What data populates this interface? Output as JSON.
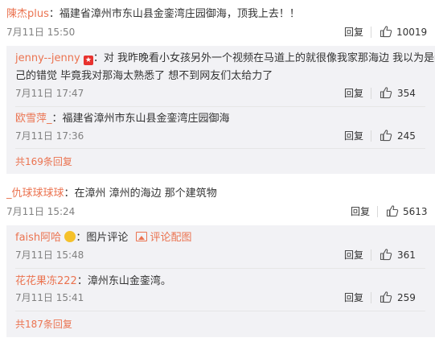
{
  "comments": [
    {
      "user": "陳杰plus",
      "text": "：福建省漳州市东山县金銮湾庄园御海，顶我上去！！",
      "time": "7月11日 15:50",
      "reply": "回复",
      "likes": "10019",
      "replies": [
        {
          "user": "jenny--jenny",
          "badge": "★",
          "text_line1": "：对 我昨晚看小女孩另外一个视频在马道上的就很像我家那海边 我以为是我自",
          "text_line2": "己的错觉 毕竟我对那海太熟悉了 想不到网友们太给力了",
          "time": "7月11日 17:47",
          "reply": "回复",
          "likes": "354"
        },
        {
          "user": "欧雪萍_",
          "text": "：福建省漳州市东山县金銮湾庄园御海",
          "time": "7月11日 17:36",
          "reply": "回复",
          "likes": "245"
        }
      ],
      "more": "共169条回复"
    },
    {
      "user": "_仇球球球球",
      "text": "：在漳州  漳州的海边  那个建筑物",
      "time": "7月11日 15:24",
      "reply": "回复",
      "likes": "5613",
      "replies": [
        {
          "user": "faish阿哈",
          "text": "：图片评论",
          "pic_link": "评论配图",
          "time": "7月11日 15:48",
          "reply": "回复",
          "likes": "361"
        },
        {
          "user": "花花果冻222",
          "text": "：漳州东山金銮湾。",
          "time": "7月11日 15:41",
          "reply": "回复",
          "likes": "259"
        }
      ],
      "more": "共187条回复"
    }
  ],
  "icons": {
    "like": "thumbs-up-icon",
    "badge": "vip-star-icon",
    "face": "emoji-face-icon",
    "picture": "picture-icon"
  },
  "colors": {
    "username": "#eb7350",
    "time": "#808080",
    "sub_bg": "#f2f2f5"
  }
}
